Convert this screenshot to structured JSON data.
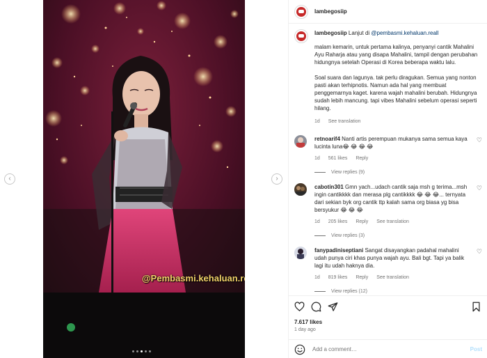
{
  "post": {
    "username": "lambegosiip",
    "media": {
      "watermark": "@Pembasmi.kehaluan.reall",
      "carousel_dots": 5,
      "active_dot": 3
    },
    "caption": {
      "username": "lambegosiip",
      "lead": "Lanjut di",
      "mention": "@pembasmi.kehaluan.reall",
      "paragraph_1": "malam kemarin, untuk pertama kalinya, penyanyi cantik Mahalini Ayu Raharja atau yang disapa Mahalini, tampil dengan perubahan hidungnya setelah Operasi di Korea beberapa waktu lalu.",
      "paragraph_2": "Soal suara dan lagunya. tak perlu diragukan. Semua yang nonton pasti akan terhipnotis. Namun ada hal yang membuat penggemarnya kaget. karena wajah mahalini berubah. Hidungnya sudah lebih mancung. tapi vibes Mahalini sebelum operasi seperti hilang.",
      "time": "1d",
      "see_translation": "See translation"
    },
    "comments": [
      {
        "username": "retnoarif4",
        "text": "Nanti artis perempuan mukanya sama semua kaya lucinta luna😂 😂 😂 😂",
        "time": "1d",
        "likes": "561 likes",
        "reply": "Reply",
        "see_translation": "",
        "view_replies": "View replies (9)"
      },
      {
        "username": "cabotin301",
        "text": "Gmn yach...udach cantik saja msh g terima...msh ingin cantikkkk dan merasa plg cantikkkk 😂 😂 😂... ternyata dari sekian byk org cantik ttp kalah sama org biasa yg bisa bersyukur 😂 😂 😂",
        "time": "1d",
        "likes": "205 likes",
        "reply": "Reply",
        "see_translation": "See translation",
        "view_replies": "View replies (3)"
      },
      {
        "username": "fanypadiniseptiani",
        "text": "Sangat disayangkan padahal mahalini udah punya ciri khas punya wajah ayu. Bali bgt. Tapi ya balik lagi itu udah haknya dia.",
        "time": "1d",
        "likes": "819 likes",
        "reply": "Reply",
        "see_translation": "See translation",
        "view_replies": "View replies (12)"
      }
    ],
    "likes_count": "7.617 likes",
    "posted_ago": "1 day ago",
    "add_comment_placeholder": "Add a comment…",
    "post_button": "Post",
    "icons": {
      "like": "heart-icon",
      "comment": "comment-icon",
      "share": "share-icon",
      "save": "bookmark-icon",
      "emoji": "emoji-icon",
      "mute": "speaker-muted-icon",
      "prev": "chevron-left-icon",
      "next": "chevron-right-icon"
    },
    "colors": {
      "link": "#00376b",
      "muted_text": "#737373",
      "post_button": "#b2dffc",
      "avatar_brand": "#c62828"
    }
  }
}
